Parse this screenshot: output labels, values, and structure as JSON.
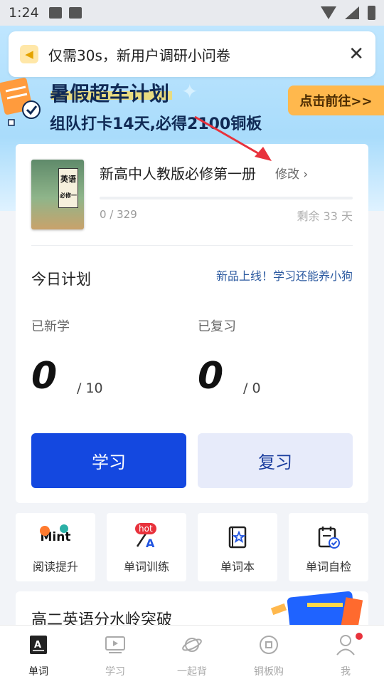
{
  "status_bar": {
    "time": "1:24"
  },
  "notice": {
    "text": "仅需30s，新用户调研小问卷",
    "close": "✕"
  },
  "promo": {
    "title": "暑假超车计划",
    "subtitle": "组队打卡14天,必得2100铜板",
    "cta": "点击前往>>"
  },
  "book": {
    "cover_label_top": "英语",
    "cover_label_bottom": "必修一",
    "title": "新高中人教版必修第一册",
    "edit": "修改 ›",
    "progress_text": "0 / 329",
    "progress_fraction": 0,
    "days_left": "剩余 33 天"
  },
  "plan": {
    "title": "今日计划",
    "link": "新品上线！学习还能养小狗",
    "new_label": "已新学",
    "new_value": "0",
    "new_total": "/ 10",
    "review_label": "已复习",
    "review_value": "0",
    "review_total": "/ 0",
    "learn_button": "学习",
    "review_button": "复习"
  },
  "tiles": [
    {
      "label": "阅读提升",
      "icon": "mint-logo-icon",
      "logo_text": "Mint"
    },
    {
      "label": "单词训练",
      "icon": "pen-a-icon",
      "badge": "hot"
    },
    {
      "label": "单词本",
      "icon": "star-book-icon"
    },
    {
      "label": "单词自检",
      "icon": "clipboard-check-icon"
    }
  ],
  "banner2": {
    "title": "高二英语分水岭突破"
  },
  "tabs": [
    {
      "label": "单词",
      "icon": "word-book-icon",
      "active": true
    },
    {
      "label": "学习",
      "icon": "play-screen-icon"
    },
    {
      "label": "一起背",
      "icon": "planet-icon"
    },
    {
      "label": "铜板购",
      "icon": "coin-icon"
    },
    {
      "label": "我",
      "icon": "person-icon",
      "dot": true
    }
  ],
  "colors": {
    "primary": "#1448e0",
    "accent_orange": "#ffb84d",
    "hero_bg": "#bfe6ff"
  }
}
